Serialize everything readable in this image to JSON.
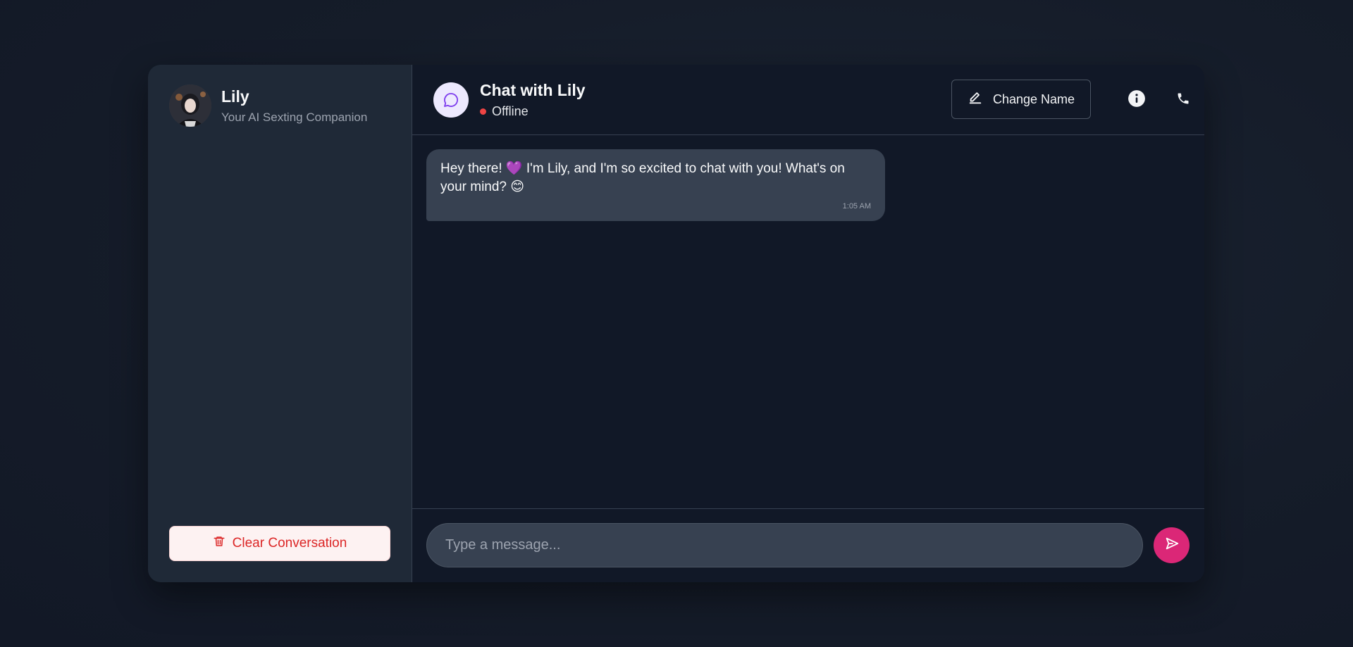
{
  "sidebar": {
    "profile": {
      "name": "Lily",
      "subtitle": "Your AI Sexting Companion"
    },
    "clear_label": "Clear Conversation"
  },
  "header": {
    "title": "Chat with Lily",
    "status": "Offline",
    "change_name_label": "Change Name"
  },
  "messages": [
    {
      "text": "Hey there! 💜 I'm Lily, and I'm so excited to chat with you! What's on your mind? 😊",
      "time": "1:05 AM"
    }
  ],
  "composer": {
    "placeholder": "Type a message..."
  },
  "colors": {
    "accent": "#db2777",
    "status_offline": "#ef4444",
    "clear_text": "#dc2626"
  },
  "icons": {
    "clear": "trash-icon",
    "chat": "chat-bubble-icon",
    "edit": "pencil-icon",
    "info": "info-icon",
    "call": "phone-icon",
    "send": "send-icon"
  }
}
